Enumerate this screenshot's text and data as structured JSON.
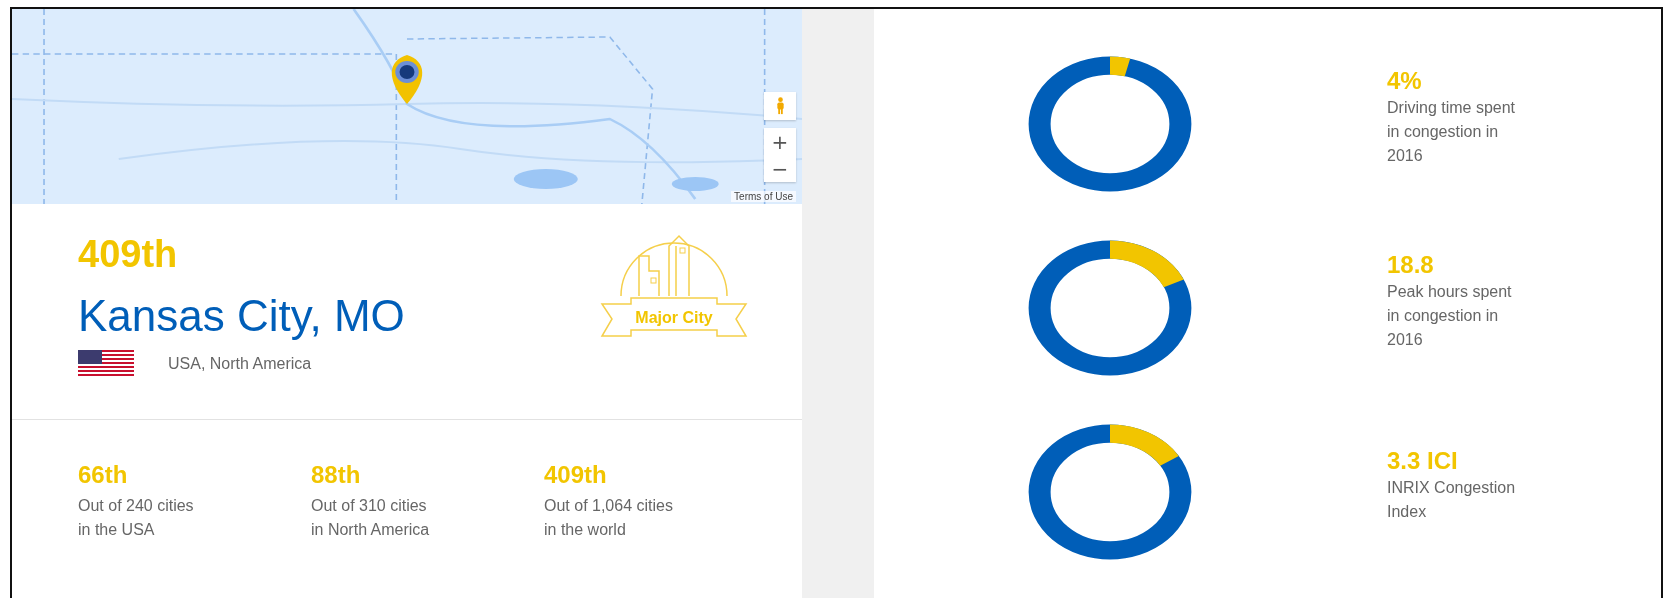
{
  "map": {
    "terms": "Terms of Use",
    "zoom_in": "+",
    "zoom_out": "−"
  },
  "city": {
    "rank": "409th",
    "name": "Kansas City, MO",
    "region": "USA, North America",
    "badge": "Major City"
  },
  "ranks": [
    {
      "value": "66th",
      "line1": "Out of 240 cities",
      "line2": "in the USA"
    },
    {
      "value": "88th",
      "line1": "Out of 310 cities",
      "line2": "in North America"
    },
    {
      "value": "409th",
      "line1": "Out of 1,064 cities",
      "line2": "in the world"
    }
  ],
  "metrics": [
    {
      "value": "4%",
      "lines": [
        "Driving time spent",
        "in congestion in",
        "2016"
      ],
      "level": 0.04
    },
    {
      "value": "18.8",
      "lines": [
        "Peak hours spent",
        "in congestion in",
        "2016"
      ],
      "level": 0.18
    },
    {
      "value": "3.3 ICI",
      "lines": [
        "INRIX Congestion",
        "Index"
      ],
      "level": 0.16
    }
  ]
}
